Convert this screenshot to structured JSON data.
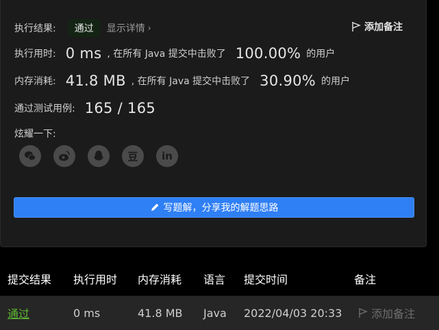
{
  "result": {
    "label": "执行结果:",
    "status": "通过",
    "detail_link": "显示详情",
    "detail_chevron": "›",
    "add_note": "添加备注"
  },
  "runtime": {
    "label": "执行用时:",
    "value": "0 ms",
    "mid": ", 在所有 Java 提交中击败了",
    "percent": "100.00%",
    "suffix": "的用户"
  },
  "memory": {
    "label": "内存消耗:",
    "value": "41.8 MB",
    "mid": ", 在所有 Java 提交中击败了",
    "percent": "30.90%",
    "suffix": "的用户"
  },
  "tests": {
    "label": "通过测试用例:",
    "value": "165 / 165"
  },
  "share": {
    "label": "炫耀一下:",
    "icons": [
      "wechat-icon",
      "weibo-icon",
      "qq-icon",
      "douban-icon",
      "linkedin-icon"
    ],
    "douban_glyph": "豆",
    "linkedin_glyph": "in"
  },
  "write_solution": "写题解，分享我的解题思路",
  "table": {
    "headers": [
      "提交结果",
      "执行用时",
      "内存消耗",
      "语言",
      "提交时间",
      "备注"
    ],
    "rows": [
      {
        "status": "通过",
        "runtime": "0 ms",
        "memory": "41.8 MB",
        "language": "Java",
        "time": "2022/04/03 20:33",
        "note": "添加备注"
      }
    ]
  },
  "colors": {
    "accent": "#2f7ff5",
    "pass": "#5fb832",
    "panel_bg": "#1b1b1b"
  }
}
